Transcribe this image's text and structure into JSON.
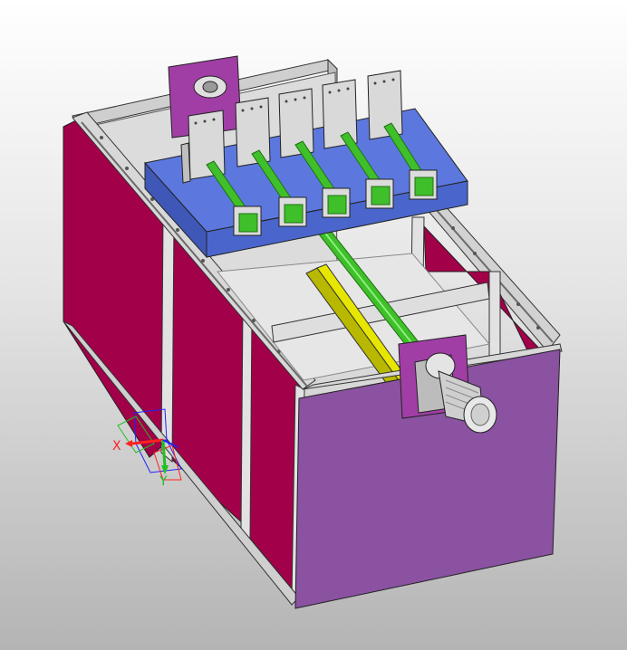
{
  "viewer": {
    "background_top": "#ffffff",
    "background_bottom": "#b4b4b4"
  },
  "model": {
    "colors": {
      "panel_magenta": "#a3004a",
      "panel_purple": "#8a52a0",
      "plate_violet": "#a13ea6",
      "platform_blue": "#4a66cc",
      "shaft_green": "#3fbf2a",
      "frame_grey": "#d6d6d6",
      "yellow_plate": "#b8b800",
      "motor_silver": "#d0d0d0"
    },
    "spindle_count": 5,
    "motor_count": 1
  },
  "triad": {
    "x_label": "X",
    "y_label": "Y",
    "x_color": "#ff2020",
    "y_color": "#20c020",
    "z_color": "#2020ff"
  }
}
